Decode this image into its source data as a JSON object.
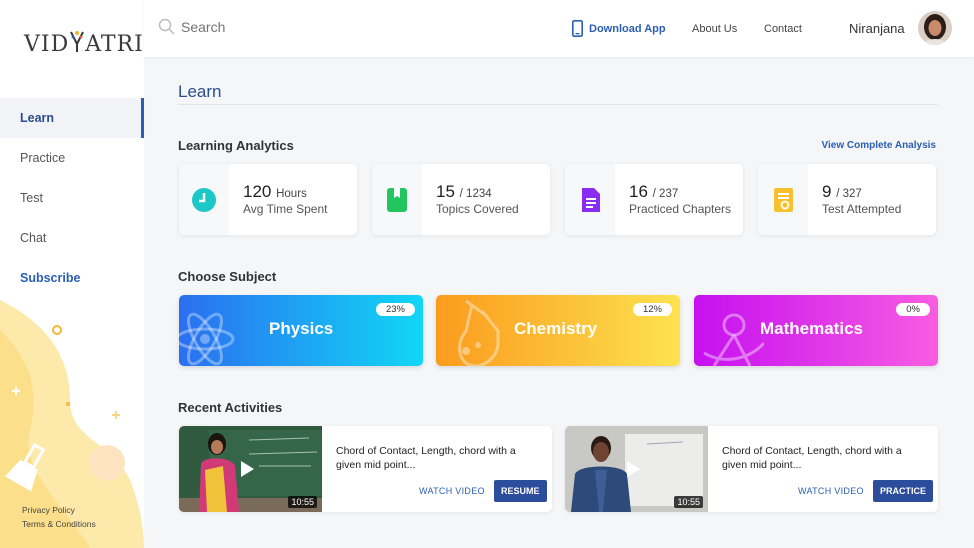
{
  "brand": {
    "logo_left": "VID",
    "logo_right": "ATRI"
  },
  "sidebar": {
    "items": [
      {
        "label": "Learn",
        "active": true
      },
      {
        "label": "Practice",
        "active": false
      },
      {
        "label": "Test",
        "active": false
      },
      {
        "label": "Chat",
        "active": false
      },
      {
        "label": "Subscribe",
        "active": false
      }
    ],
    "footer_links": [
      "Privacy Policy",
      "Terms & Conditions"
    ]
  },
  "header": {
    "search_placeholder": "Search",
    "download_label": "Download App",
    "about_label": "About Us",
    "contact_label": "Contact",
    "user_name": "Niranjana"
  },
  "page": {
    "title": "Learn",
    "analytics_title": "Learning Analytics",
    "view_analysis": "View Complete Analysis",
    "stats": [
      {
        "value": "120",
        "unit": "Hours",
        "label": "Avg Time Spent",
        "icon": "clock-icon",
        "color": "#1bc7c7"
      },
      {
        "value": "15",
        "unit": "/ 1234",
        "label": "Topics Covered",
        "icon": "book-icon",
        "color": "#22c55e"
      },
      {
        "value": "16",
        "unit": "/ 237",
        "label": "Practiced Chapters",
        "icon": "document-icon",
        "color": "#8b2cf5"
      },
      {
        "value": "9",
        "unit": "/ 327",
        "label": "Test Attempted",
        "icon": "test-icon",
        "color": "#f6c02e"
      }
    ],
    "subject_title": "Choose Subject",
    "subjects": [
      {
        "name": "Physics",
        "percent": "23%",
        "icon": "atom-icon"
      },
      {
        "name": "Chemistry",
        "percent": "12%",
        "icon": "flask-icon"
      },
      {
        "name": "Mathematics",
        "percent": "0%",
        "icon": "compass-icon"
      }
    ],
    "recent_title": "Recent Activities",
    "activities": [
      {
        "title": "Chord of Contact, Length, chord with a given mid point...",
        "duration": "10:55",
        "watch": "WATCH VIDEO",
        "action": "RESUME"
      },
      {
        "title": "Chord of Contact, Length, chord with a given mid point...",
        "duration": "10:55",
        "watch": "WATCH VIDEO",
        "action": "PRACTICE"
      }
    ]
  }
}
